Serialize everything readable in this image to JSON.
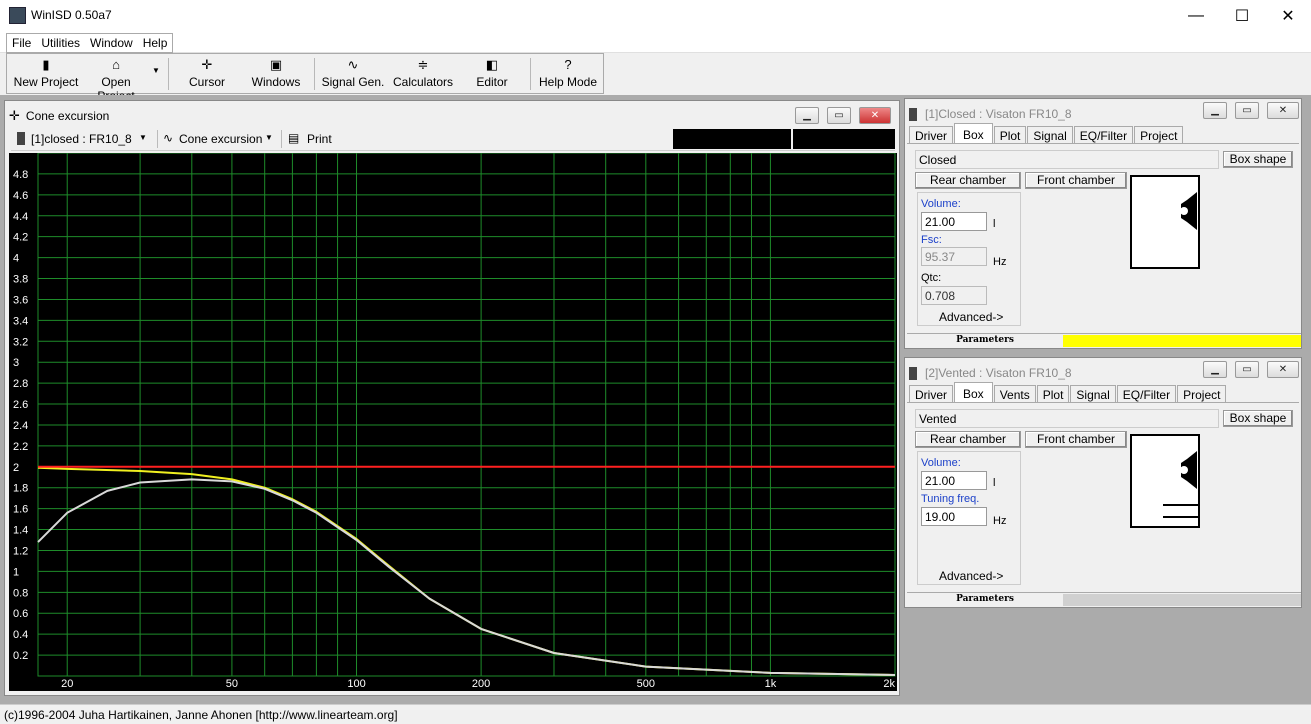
{
  "app": {
    "title": "WinISD 0.50a7",
    "minimize": "—",
    "maximize": "☐",
    "close": "✕"
  },
  "menu": [
    "File",
    "Utilities",
    "Window",
    "Help"
  ],
  "toolbar": [
    {
      "label": "New Project",
      "icon": "new-project-icon",
      "glyph": "▮"
    },
    {
      "label": "Open Project",
      "icon": "open-folder-icon",
      "glyph": "⌂"
    },
    {
      "label": "Cursor",
      "icon": "cursor-icon",
      "glyph": "✛"
    },
    {
      "label": "Windows",
      "icon": "windows-icon",
      "glyph": "▣"
    },
    {
      "label": "Signal Gen.",
      "icon": "signal-icon",
      "glyph": "∿"
    },
    {
      "label": "Calculators",
      "icon": "calculator-icon",
      "glyph": "≑"
    },
    {
      "label": "Editor",
      "icon": "editor-icon",
      "glyph": "◧"
    },
    {
      "label": "Help Mode",
      "icon": "help-icon",
      "glyph": "?"
    }
  ],
  "graph": {
    "title": "Cone excursion",
    "project_select": "[1]closed : FR10_8",
    "graph_select": "Cone excursion",
    "print": "Print",
    "colors": {
      "bg": "#000000",
      "grid": "#1e8c2a",
      "closed": "#f0f020",
      "vented": "#d9d9d9",
      "limit": "#ff2020"
    }
  },
  "chart_data": {
    "type": "line",
    "xscale": "log",
    "xlim": [
      17,
      2000
    ],
    "ylim": [
      0,
      5
    ],
    "grid": true,
    "y_ticks": [
      4.8,
      4.6,
      4.4,
      4.2,
      4,
      3.8,
      3.6,
      3.4,
      3.2,
      3,
      2.8,
      2.6,
      2.4,
      2.2,
      2,
      1.8,
      1.6,
      1.4,
      1.2,
      1,
      0.8,
      0.6,
      0.4,
      0.2
    ],
    "x_ticks": [
      {
        "v": 20,
        "label": "20"
      },
      {
        "v": 50,
        "label": "50"
      },
      {
        "v": 100,
        "label": "100"
      },
      {
        "v": 200,
        "label": "200"
      },
      {
        "v": 500,
        "label": "500"
      },
      {
        "v": 1000,
        "label": "1k"
      },
      {
        "v": 2000,
        "label": "2k"
      }
    ],
    "x_grid_minor": [
      30,
      40,
      60,
      70,
      80,
      90,
      300,
      400,
      600,
      700,
      800,
      900
    ],
    "series": [
      {
        "x": [
          17,
          20,
          30,
          40,
          50,
          60,
          70,
          80,
          100,
          120,
          150,
          200,
          300,
          500,
          1000,
          2000
        ],
        "y": [
          1.99,
          1.98,
          1.96,
          1.93,
          1.88,
          1.8,
          1.69,
          1.57,
          1.31,
          1.05,
          0.74,
          0.45,
          0.22,
          0.09,
          0.03,
          0.01
        ]
      },
      {
        "x": [
          17,
          20,
          25,
          30,
          40,
          50,
          60,
          70,
          80,
          100,
          120,
          150,
          200,
          300,
          500,
          1000,
          2000
        ],
        "y": [
          1.28,
          1.56,
          1.77,
          1.85,
          1.88,
          1.86,
          1.79,
          1.68,
          1.56,
          1.3,
          1.04,
          0.74,
          0.45,
          0.22,
          0.09,
          0.03,
          0.01
        ]
      },
      {
        "x": [
          17,
          2000
        ],
        "y": [
          2.0,
          2.0
        ]
      }
    ]
  },
  "closed": {
    "title": "[1]Closed : Visaton FR10_8",
    "tabs": [
      "Driver",
      "Box",
      "Plot",
      "Signal",
      "EQ/Filter",
      "Project"
    ],
    "selected_tab": 1,
    "type": "Closed",
    "box_shape": "Box shape",
    "rear": "Rear chamber",
    "front": "Front chamber",
    "volume_label": "Volume:",
    "volume": "21.00",
    "volume_unit": "l",
    "fsc_label": "Fsc:",
    "fsc": "95.37",
    "fsc_unit": "Hz",
    "qtc_label": "Qtc:",
    "qtc": "0.708",
    "advanced": "Advanced->",
    "params": "Parameters",
    "status_color": "#ffff00"
  },
  "vented": {
    "title": "[2]Vented : Visaton FR10_8",
    "tabs": [
      "Driver",
      "Box",
      "Vents",
      "Plot",
      "Signal",
      "EQ/Filter",
      "Project"
    ],
    "selected_tab": 1,
    "type": "Vented",
    "box_shape": "Box shape",
    "rear": "Rear chamber",
    "front": "Front chamber",
    "volume_label": "Volume:",
    "volume": "21.00",
    "volume_unit": "l",
    "tuning_label": "Tuning freq.",
    "tuning": "19.00",
    "tuning_unit": "Hz",
    "advanced": "Advanced->",
    "params": "Parameters",
    "status_color": "#d0d0d0"
  },
  "status": "(c)1996-2004 Juha Hartikainen, Janne Ahonen [http://www.linearteam.org]"
}
